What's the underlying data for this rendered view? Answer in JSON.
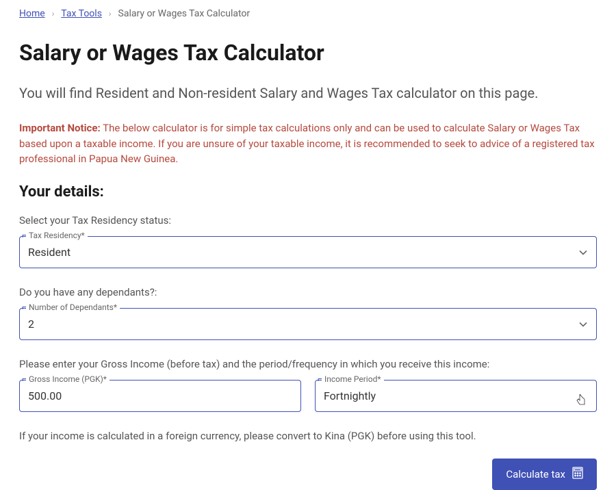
{
  "breadcrumb": {
    "home": "Home",
    "tax_tools": "Tax Tools",
    "current": "Salary or Wages Tax Calculator"
  },
  "page": {
    "title": "Salary or Wages Tax Calculator",
    "subtitle": "You will find Resident and Non-resident Salary and Wages Tax calculator on this page."
  },
  "notice": {
    "label": "Important Notice:",
    "text": " The below calculator is for simple tax calculations only and can be used to calculate Salary or Wages Tax based upon a taxable income. If you are unsure of your taxable income, it is recommended to seek to advice of a registered tax professional in Papua New Guinea."
  },
  "section_heading": "Your details:",
  "fields": {
    "residency": {
      "description": "Select your Tax Residency status:",
      "label": "Tax Residency*",
      "value": "Resident"
    },
    "dependants": {
      "description": "Do you have any dependants?:",
      "label": "Number of Dependants*",
      "value": "2"
    },
    "income_intro": "Please enter your Gross Income (before tax) and the period/frequency in which you receive this income:",
    "gross_income": {
      "label": "Gross Income (PGK)*",
      "value": "500.00"
    },
    "income_period": {
      "label": "Income Period*",
      "value": "Fortnightly"
    }
  },
  "currency_note": "If your income is calculated in a foreign currency, please convert to Kina (PGK) before using this tool.",
  "buttons": {
    "calculate": "Calculate tax"
  }
}
